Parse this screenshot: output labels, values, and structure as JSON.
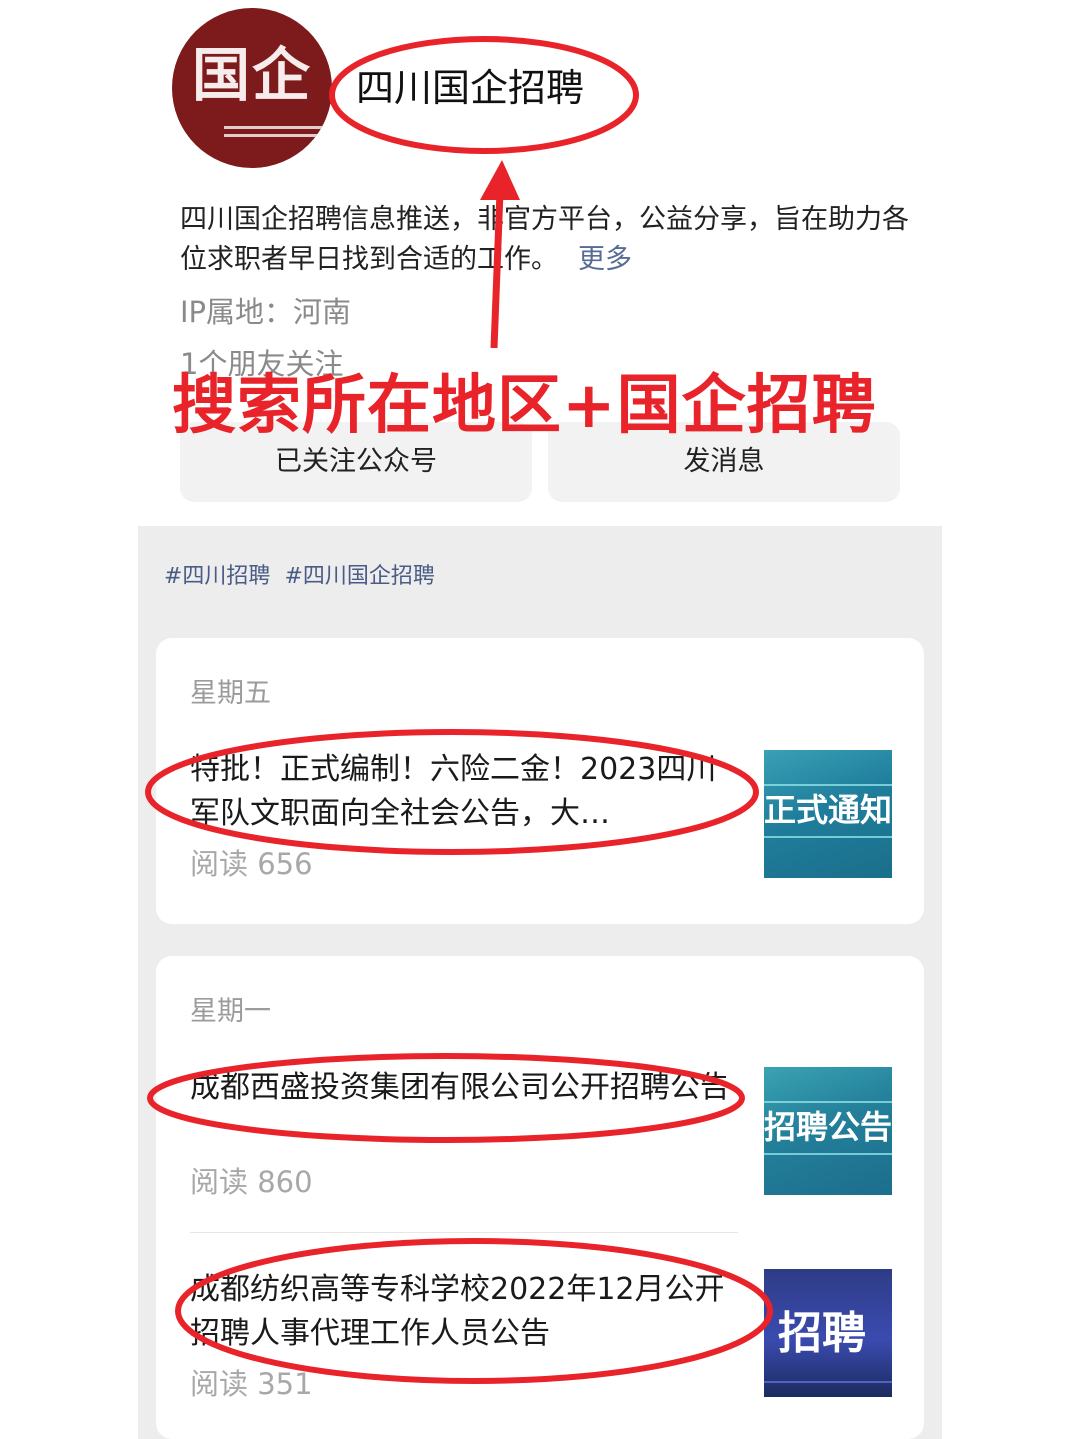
{
  "profile": {
    "avatar_text": "国企",
    "account_name": "四川国企招聘",
    "description_part1": "四川国企招聘信息推送，非官方平台，公益分享，旨在助力各位求职者早日找到合适的工作。",
    "more_label": "更多",
    "ip_location": "IP属地：河南",
    "friends_following": "1个朋友关注"
  },
  "actions": {
    "followed_label": "已关注公众号",
    "message_label": "发消息"
  },
  "annotation": {
    "caption": "搜索所在地区+国企招聘",
    "color": "#e8242a"
  },
  "feed": {
    "tags": [
      "#四川招聘",
      "#四川国企招聘"
    ],
    "groups": [
      {
        "day": "星期五",
        "articles": [
          {
            "title": "特批！正式编制！六险二金！2023四川军队文职面向全社会公告，大…",
            "reads": "阅读 656",
            "thumb_text": "正式通知"
          }
        ]
      },
      {
        "day": "星期一",
        "articles": [
          {
            "title": "成都西盛投资集团有限公司公开招聘公告",
            "reads": "阅读 860",
            "thumb_text": "招聘公告"
          },
          {
            "title": "成都纺织高等专科学校2022年12月公开招聘人事代理工作人员公告",
            "reads": "阅读 351",
            "thumb_text": "招聘"
          }
        ]
      }
    ]
  },
  "colors": {
    "link": "#576b95",
    "avatar_bg": "#7d1a1c",
    "feed_bg": "#ededed"
  }
}
